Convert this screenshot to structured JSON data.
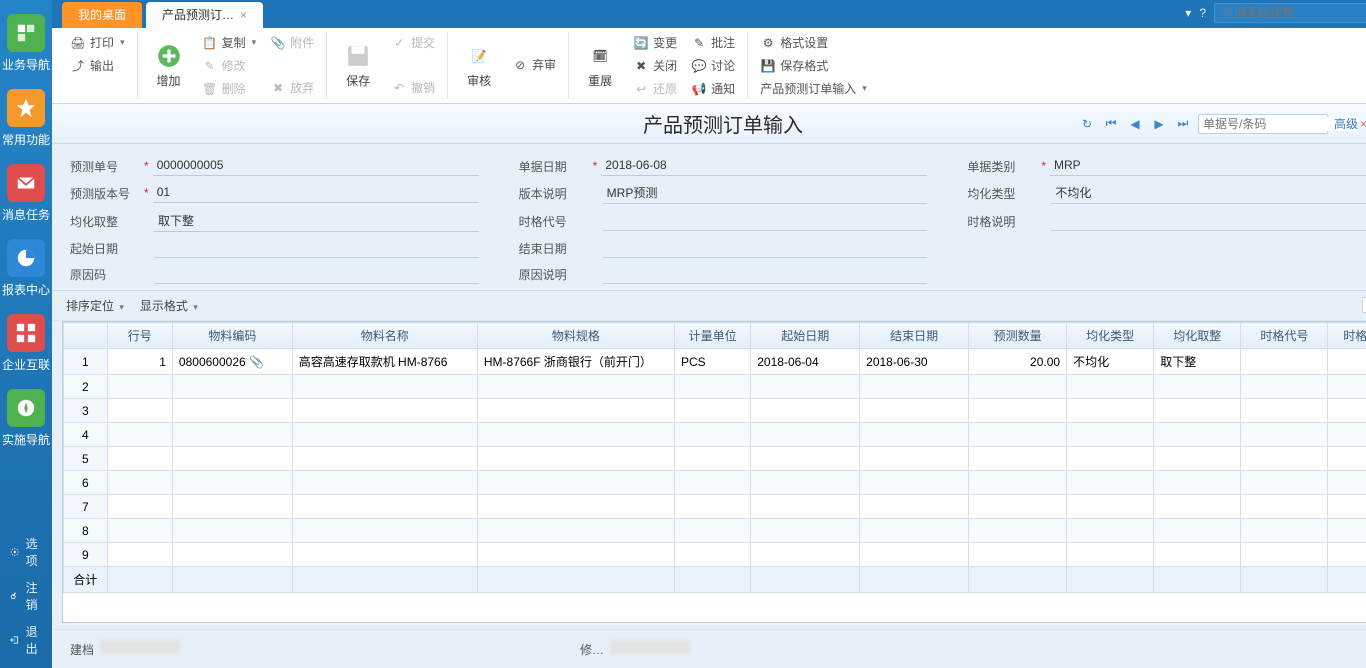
{
  "sidebar": {
    "items": [
      {
        "label": "业务导航",
        "icon": "nav-icon",
        "color": "#4fb14f"
      },
      {
        "label": "常用功能",
        "icon": "star-icon",
        "color": "#f39a2b"
      },
      {
        "label": "消息任务",
        "icon": "mail-icon",
        "color": "#e04d4d"
      },
      {
        "label": "报表中心",
        "icon": "report-icon",
        "color": "#2f88d6"
      },
      {
        "label": "企业互联",
        "icon": "connect-icon",
        "color": "#e04d4d"
      },
      {
        "label": "实施导航",
        "icon": "compass-icon",
        "color": "#4fb14f"
      }
    ],
    "footer": [
      {
        "label": "选项",
        "icon": "gear-icon"
      },
      {
        "label": "注销",
        "icon": "key-icon"
      },
      {
        "label": "退出",
        "icon": "exit-icon"
      }
    ]
  },
  "tabs": {
    "inactive": "我的桌面",
    "active": "产品预测订…"
  },
  "top_search_placeholder": "单据条码搜索",
  "ribbon": {
    "print": "打印",
    "export": "输出",
    "add": "增加",
    "copy": "复制",
    "edit": "修改",
    "delete": "删除",
    "attach": "附件",
    "discard": "放弃",
    "save": "保存",
    "submit": "提交",
    "undo": "撤销",
    "audit": "审核",
    "abandon": "弃审",
    "reshow": "重展",
    "change": "变更",
    "close": "关闭",
    "return": "还原",
    "annotate": "批注",
    "discuss": "讨论",
    "notify": "通知",
    "format_set": "格式设置",
    "format_save": "保存格式",
    "format_input": "产品预测订单输入"
  },
  "title": "产品预测订单输入",
  "title_search_placeholder": "单据号/条码",
  "advanced": "高级",
  "form": {
    "order_no": {
      "label": "预测单号",
      "value": "0000000005"
    },
    "order_date": {
      "label": "单据日期",
      "value": "2018-06-08"
    },
    "doc_type": {
      "label": "单据类别",
      "value": "MRP"
    },
    "version_no": {
      "label": "预测版本号",
      "value": "01"
    },
    "version_desc": {
      "label": "版本说明",
      "value": "MRP预测"
    },
    "avg_type": {
      "label": "均化类型",
      "value": "不均化"
    },
    "round": {
      "label": "均化取整",
      "value": "取下整"
    },
    "grid_code": {
      "label": "时格代号",
      "value": ""
    },
    "grid_desc": {
      "label": "时格说明",
      "value": ""
    },
    "start_date": {
      "label": "起始日期",
      "value": ""
    },
    "end_date": {
      "label": "结束日期",
      "value": ""
    },
    "reason_code": {
      "label": "原因码",
      "value": ""
    },
    "reason_desc": {
      "label": "原因说明",
      "value": ""
    }
  },
  "grid_controls": {
    "sort": "排序定位",
    "display": "显示格式"
  },
  "grid": {
    "headers": [
      "行号",
      "物料编码",
      "物料名称",
      "物料规格",
      "计量单位",
      "起始日期",
      "结束日期",
      "预测数量",
      "均化类型",
      "均化取整",
      "时格代号",
      "时格"
    ],
    "rows": [
      {
        "num": 1,
        "line": "1",
        "code": "0800600026",
        "name": "高容高速存取款机 HM-8766",
        "spec": "HM-8766F 浙商银行（前开门）",
        "unit": "PCS",
        "start": "2018-06-04",
        "end": "2018-06-30",
        "qty": "20.00",
        "avg": "不均化",
        "round": "取下整",
        "grid": "",
        "grid2": ""
      },
      {
        "num": 2
      },
      {
        "num": 3
      },
      {
        "num": 4
      },
      {
        "num": 5
      },
      {
        "num": 6
      },
      {
        "num": 7
      },
      {
        "num": 8
      },
      {
        "num": 9
      }
    ],
    "total_label": "合计"
  },
  "footer": {
    "creator": "建档",
    "editor": "修…"
  }
}
